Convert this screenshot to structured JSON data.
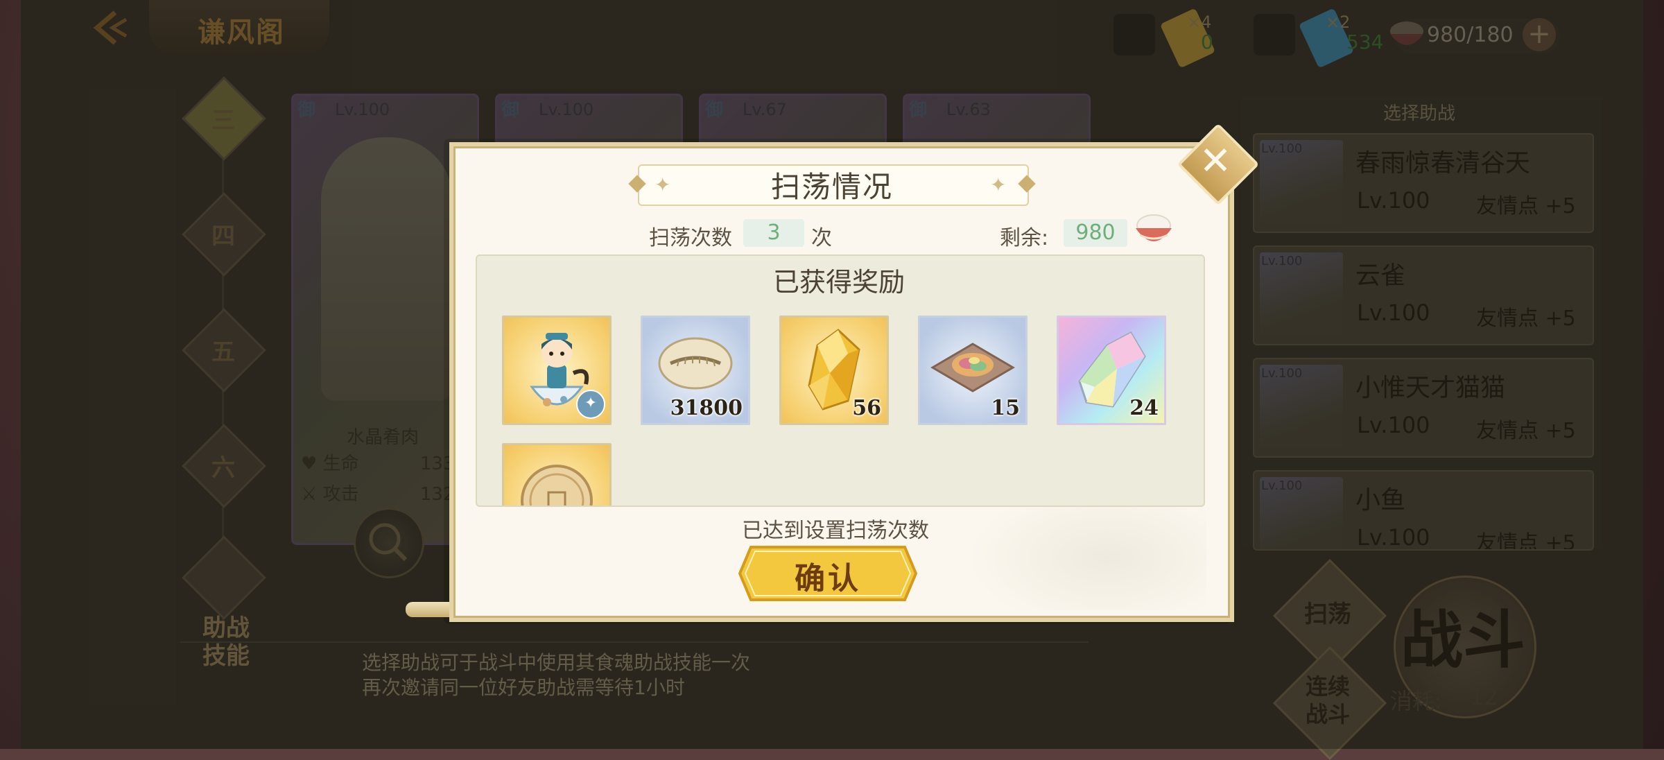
{
  "header": {
    "title": "谦风阁",
    "ticket_gold": {
      "multiplier": "×4",
      "value": "0"
    },
    "ticket_blue": {
      "multiplier": "×2",
      "value": "534"
    },
    "stamina": "980/180"
  },
  "chapters": [
    "三",
    "四",
    "五",
    "六"
  ],
  "assist": {
    "label_line1": "助战",
    "label_line2": "技能",
    "desc_line1": "选择助战可于战斗中使用其食魂助战技能一次",
    "desc_line2": "再次邀请同一位好友助战需等待1小时"
  },
  "team": [
    {
      "badge": "御",
      "level": "Lv.100",
      "name": "水晶肴肉"
    },
    {
      "badge": "御",
      "level": "Lv.100"
    },
    {
      "badge": "御",
      "level": "Lv.67"
    },
    {
      "badge": "御",
      "level": "Lv.63"
    }
  ],
  "stats": [
    {
      "label": "生命",
      "value": "1332"
    },
    {
      "label": "攻击",
      "value": "132"
    }
  ],
  "helpers": {
    "title": "选择助战",
    "list": [
      {
        "lvtag": "Lv.100",
        "name": "春雨惊春清谷天",
        "level": "Lv.100",
        "friend": "友情点 +5"
      },
      {
        "lvtag": "Lv.100",
        "name": "云雀",
        "level": "Lv.100",
        "friend": "友情点 +5"
      },
      {
        "lvtag": "Lv.100",
        "name": "小惟天才猫猫",
        "level": "Lv.100",
        "friend": "友情点 +5"
      },
      {
        "lvtag": "Lv.100",
        "name": "小鱼",
        "level": "Lv.100",
        "friend": "友情点 +5"
      }
    ]
  },
  "actions": {
    "sweep": "扫荡",
    "continuous_line1": "连续",
    "continuous_line2": "战斗",
    "battle": "战斗",
    "cost_label": "消耗:",
    "cost_value": "12"
  },
  "modal": {
    "title": "扫荡情况",
    "sweep_count_label": "扫荡次数",
    "sweep_count": "3",
    "unit": "次",
    "remain_label": "剩余:",
    "remain_value": "980",
    "rewards_title": "已获得奖励",
    "rewards": [
      {
        "icon": "chibi-character-icon",
        "count": ""
      },
      {
        "icon": "shell-icon",
        "count": "31800"
      },
      {
        "icon": "gold-crystal-icon",
        "count": "56"
      },
      {
        "icon": "rainbow-cake-icon",
        "count": "15"
      },
      {
        "icon": "rainbow-crystal-icon",
        "count": "24"
      },
      {
        "icon": "coin-icon",
        "count": ""
      }
    ],
    "status": "已达到设置扫荡次数",
    "confirm": "确认"
  },
  "colors": {
    "accent_gold": "#f1c84b",
    "value_green": "#6fae79",
    "modal_bg": "#fbf7ee"
  }
}
